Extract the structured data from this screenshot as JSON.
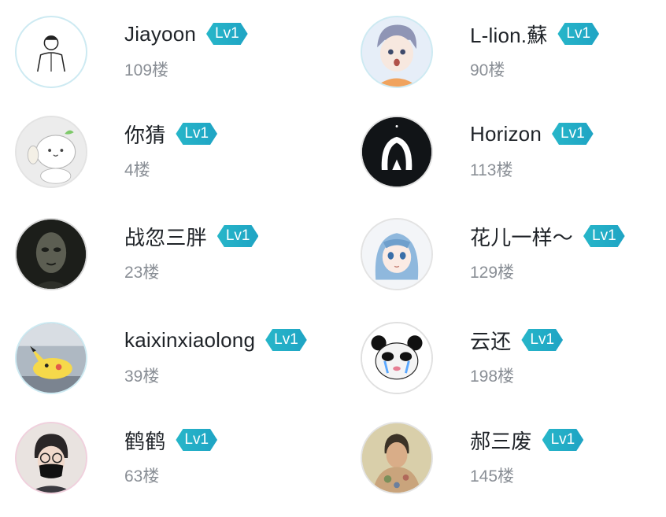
{
  "badge_label": "Lv1",
  "users": [
    {
      "name": "Jiayoon",
      "floor": "109楼",
      "avatar_icon": "sketch-person-avatar"
    },
    {
      "name": "L-lion.蘇",
      "floor": "90楼",
      "avatar_icon": "anime-boy-avatar"
    },
    {
      "name": "你猜",
      "floor": "4楼",
      "avatar_icon": "cute-sprout-mascot-avatar"
    },
    {
      "name": "Horizon",
      "floor": "113楼",
      "avatar_icon": "penguin-logo-avatar"
    },
    {
      "name": "战忽三胖",
      "floor": "23楼",
      "avatar_icon": "dark-face-avatar"
    },
    {
      "name": "花儿一样～",
      "floor": "129楼",
      "avatar_icon": "anime-girl-avatar"
    },
    {
      "name": "kaixinxiaolong",
      "floor": "39楼",
      "avatar_icon": "pikachu-avatar"
    },
    {
      "name": "云还",
      "floor": "198楼",
      "avatar_icon": "panda-meme-avatar"
    },
    {
      "name": "鹤鹤",
      "floor": "63楼",
      "avatar_icon": "masked-person-avatar"
    },
    {
      "name": "郝三废",
      "floor": "145楼",
      "avatar_icon": "painted-portrait-avatar"
    }
  ],
  "colors": {
    "badge": "#22AFC7",
    "name": "#1F2328",
    "floor": "#8A8F96",
    "avatar_ring": "#CDEAF2"
  }
}
